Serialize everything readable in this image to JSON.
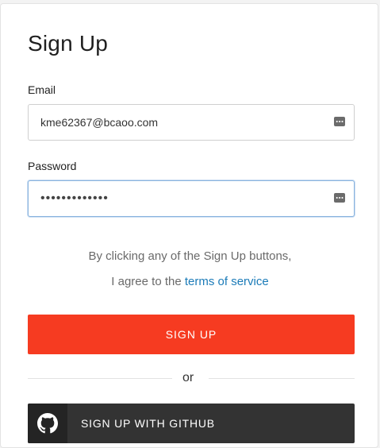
{
  "form": {
    "title": "Sign Up",
    "email": {
      "label": "Email",
      "value": "kme62367@bcaoo.com"
    },
    "password": {
      "label": "Password",
      "value": "•••••••••••••"
    },
    "terms": {
      "line1": "By clicking any of the Sign Up buttons,",
      "line2_prefix": "I agree to the ",
      "link_text": "terms of service"
    },
    "signup_button": "SIGN UP",
    "divider_text": "or",
    "github_button": "SIGN UP WITH GITHUB"
  },
  "colors": {
    "primary": "#f63b21",
    "github": "#333333",
    "link": "#1b7bb8"
  },
  "icons": {
    "autofill": "password-manager-key-icon",
    "github": "github-octocat-icon"
  }
}
